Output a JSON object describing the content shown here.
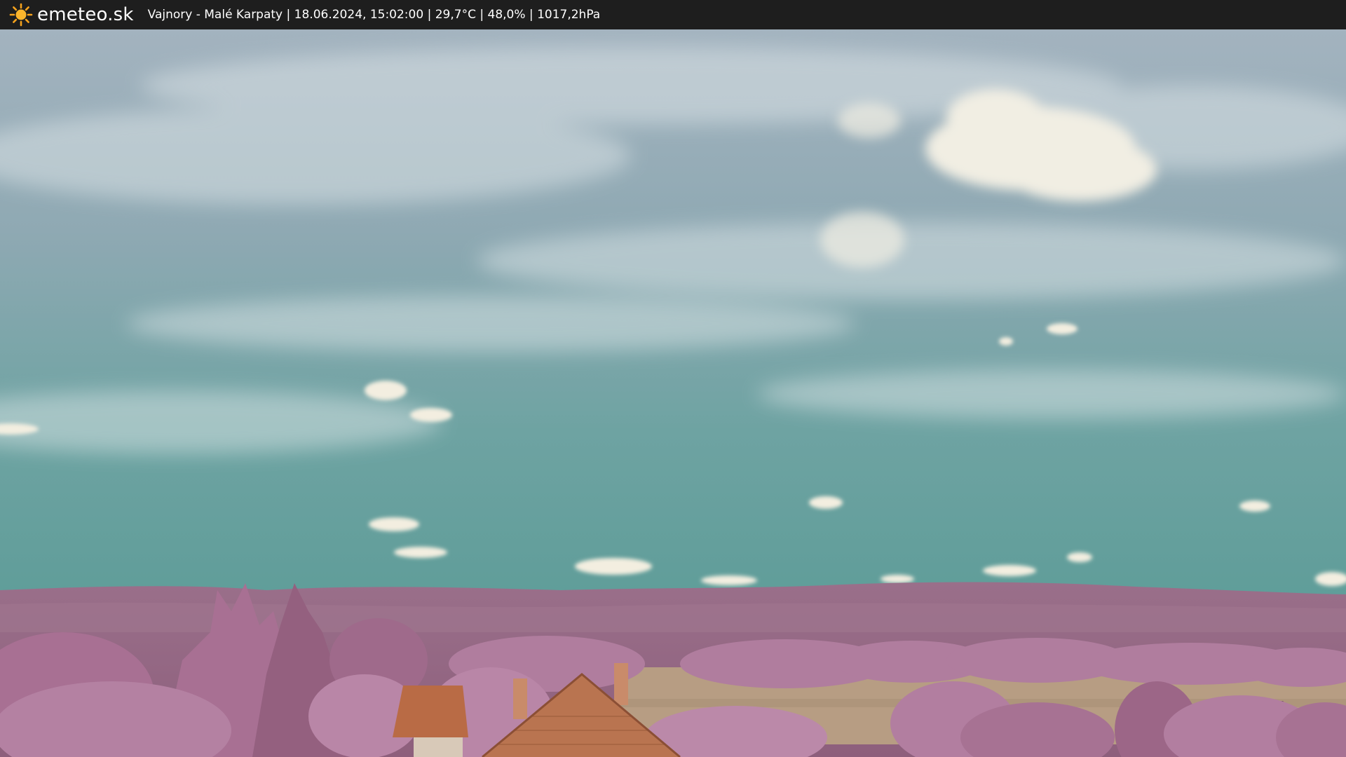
{
  "header": {
    "logo_icon": "sun-icon",
    "site_name": "emeteo.sk",
    "location": "Vajnory - Malé Karpaty",
    "datetime": "18.06.2024, 15:02:00",
    "temperature": "29,7°C",
    "humidity": "48,0%",
    "pressure": "1017,2hPa",
    "separator": " | "
  },
  "colors": {
    "bar_background": "#1e1e1e",
    "sky_top": "#9fb1bf",
    "sky_bottom": "#5f9c98",
    "hills": "#9a6f8a",
    "foliage": "#b27ea0",
    "field": "#b79d83",
    "roof": "#b96b45"
  }
}
